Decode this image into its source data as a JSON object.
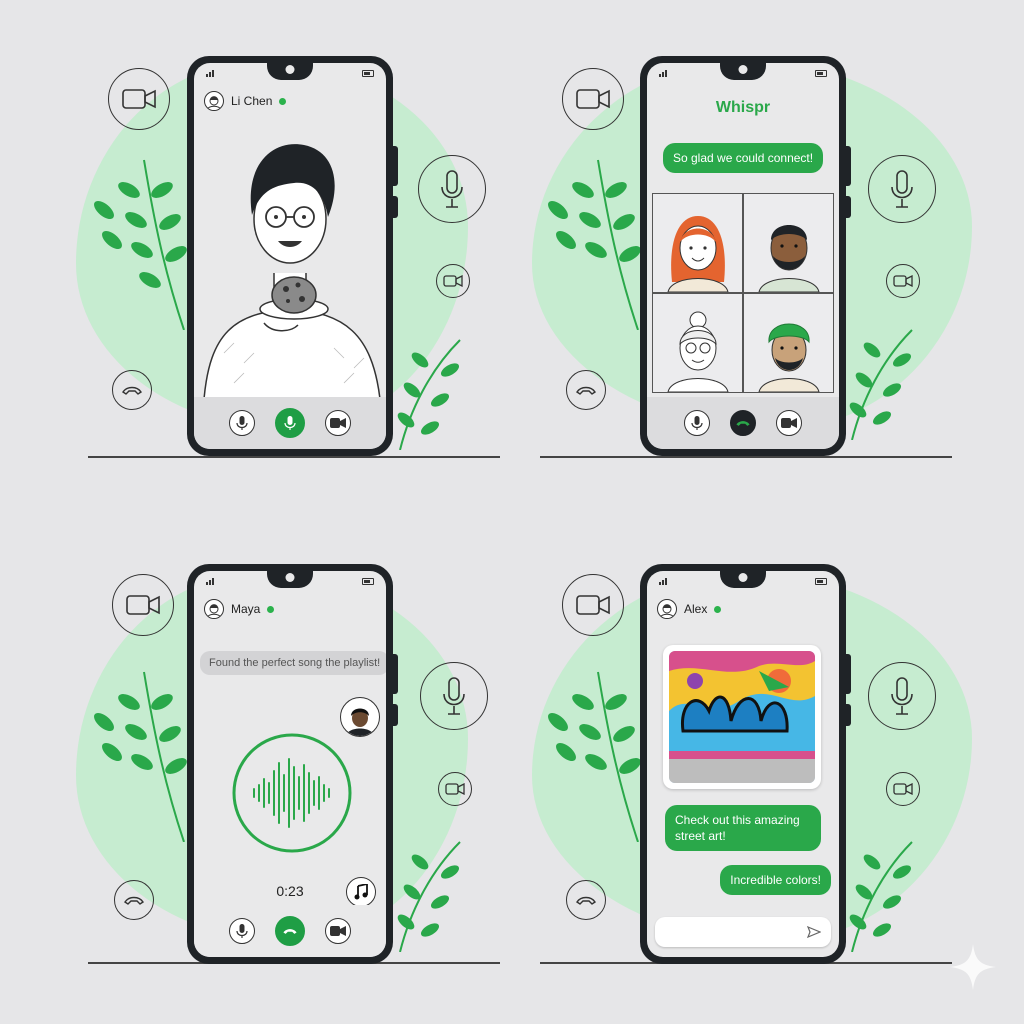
{
  "screens": [
    {
      "contact": "Li Chen",
      "icons": [
        "video-icon",
        "microphone-icon",
        "video-small-icon",
        "phone-icon"
      ]
    },
    {
      "app_title": "Whispr",
      "message": "So glad we could connect!",
      "icons": [
        "video-icon",
        "microphone-icon",
        "video-small-icon",
        "phone-icon"
      ]
    },
    {
      "contact": "Maya",
      "message": "Found the perfect song the playlist!",
      "timer": "0:23",
      "icons": [
        "video-icon",
        "microphone-icon",
        "video-small-icon",
        "phone-icon"
      ]
    },
    {
      "contact": "Alex",
      "messages": [
        "Check out this amazing street art!",
        "Incredible colors!"
      ],
      "icons": [
        "video-icon",
        "microphone-icon",
        "video-small-icon",
        "phone-icon",
        "send-icon"
      ]
    }
  ],
  "colors": {
    "accent": "#2aa84a",
    "blob": "#bfeccb",
    "phone": "#1f2327",
    "background": "#e6e6e8"
  }
}
